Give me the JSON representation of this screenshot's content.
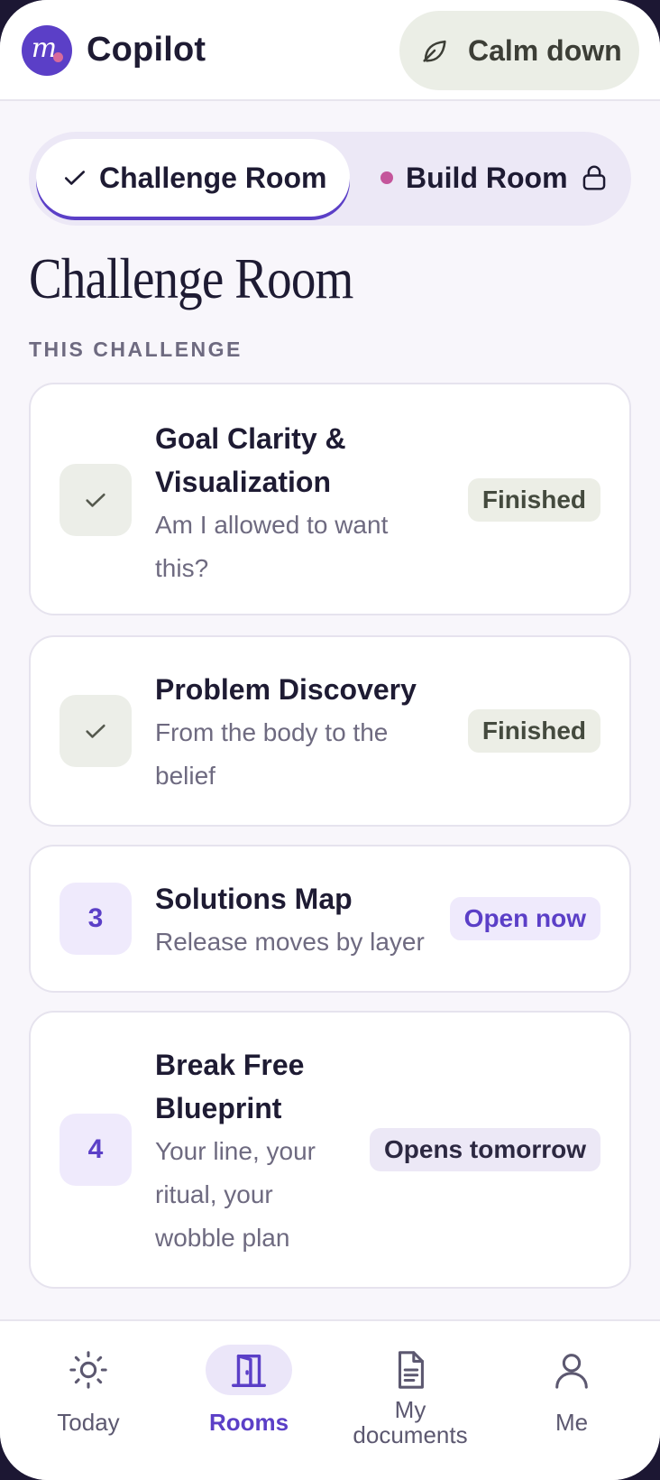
{
  "header": {
    "logo_letter": "m",
    "app_title": "Copilot",
    "calm_button_label": "Calm down",
    "calm_icon": "leaf-icon"
  },
  "tabs": {
    "active": {
      "label": "Challenge Room",
      "icon": "check-icon"
    },
    "inactive": {
      "label": "Build Room",
      "icon": "lock-icon"
    }
  },
  "page": {
    "title": "Challenge Room",
    "section_label": "THIS CHALLENGE"
  },
  "steps": [
    {
      "marker": "",
      "marker_icon": "check-icon",
      "title_lines": [
        "Goal Clarity &",
        "Visualization"
      ],
      "subtitle_lines": [
        "Am I allowed to want",
        "this?"
      ],
      "status": "Finished"
    },
    {
      "marker": "",
      "marker_icon": "check-icon",
      "title_lines": [
        "Problem Discovery"
      ],
      "subtitle_lines": [
        "From the body to the",
        "belief"
      ],
      "status": "Finished"
    },
    {
      "marker": "3",
      "title_lines": [
        "Solutions Map"
      ],
      "subtitle_lines": [
        "Release moves by layer"
      ],
      "status": "Open now"
    },
    {
      "marker": "4",
      "title_lines": [
        "Break Free",
        "Blueprint"
      ],
      "subtitle_lines": [
        "Your line, your",
        "ritual, your",
        "wobble plan"
      ],
      "status": "Opens tomorrow"
    }
  ],
  "nav": {
    "items": [
      {
        "label": "Today",
        "icon": "sun-icon",
        "active": false
      },
      {
        "label": "Rooms",
        "icon": "door-icon",
        "active": true
      },
      {
        "label_lines": [
          "My",
          "documents"
        ],
        "icon": "document-icon",
        "active": false
      },
      {
        "label": "Me",
        "icon": "user-icon",
        "active": false
      }
    ]
  },
  "colors": {
    "accent": "#5b3fc7",
    "pink_dot": "#c4559b",
    "background": "#f8f6fb"
  }
}
